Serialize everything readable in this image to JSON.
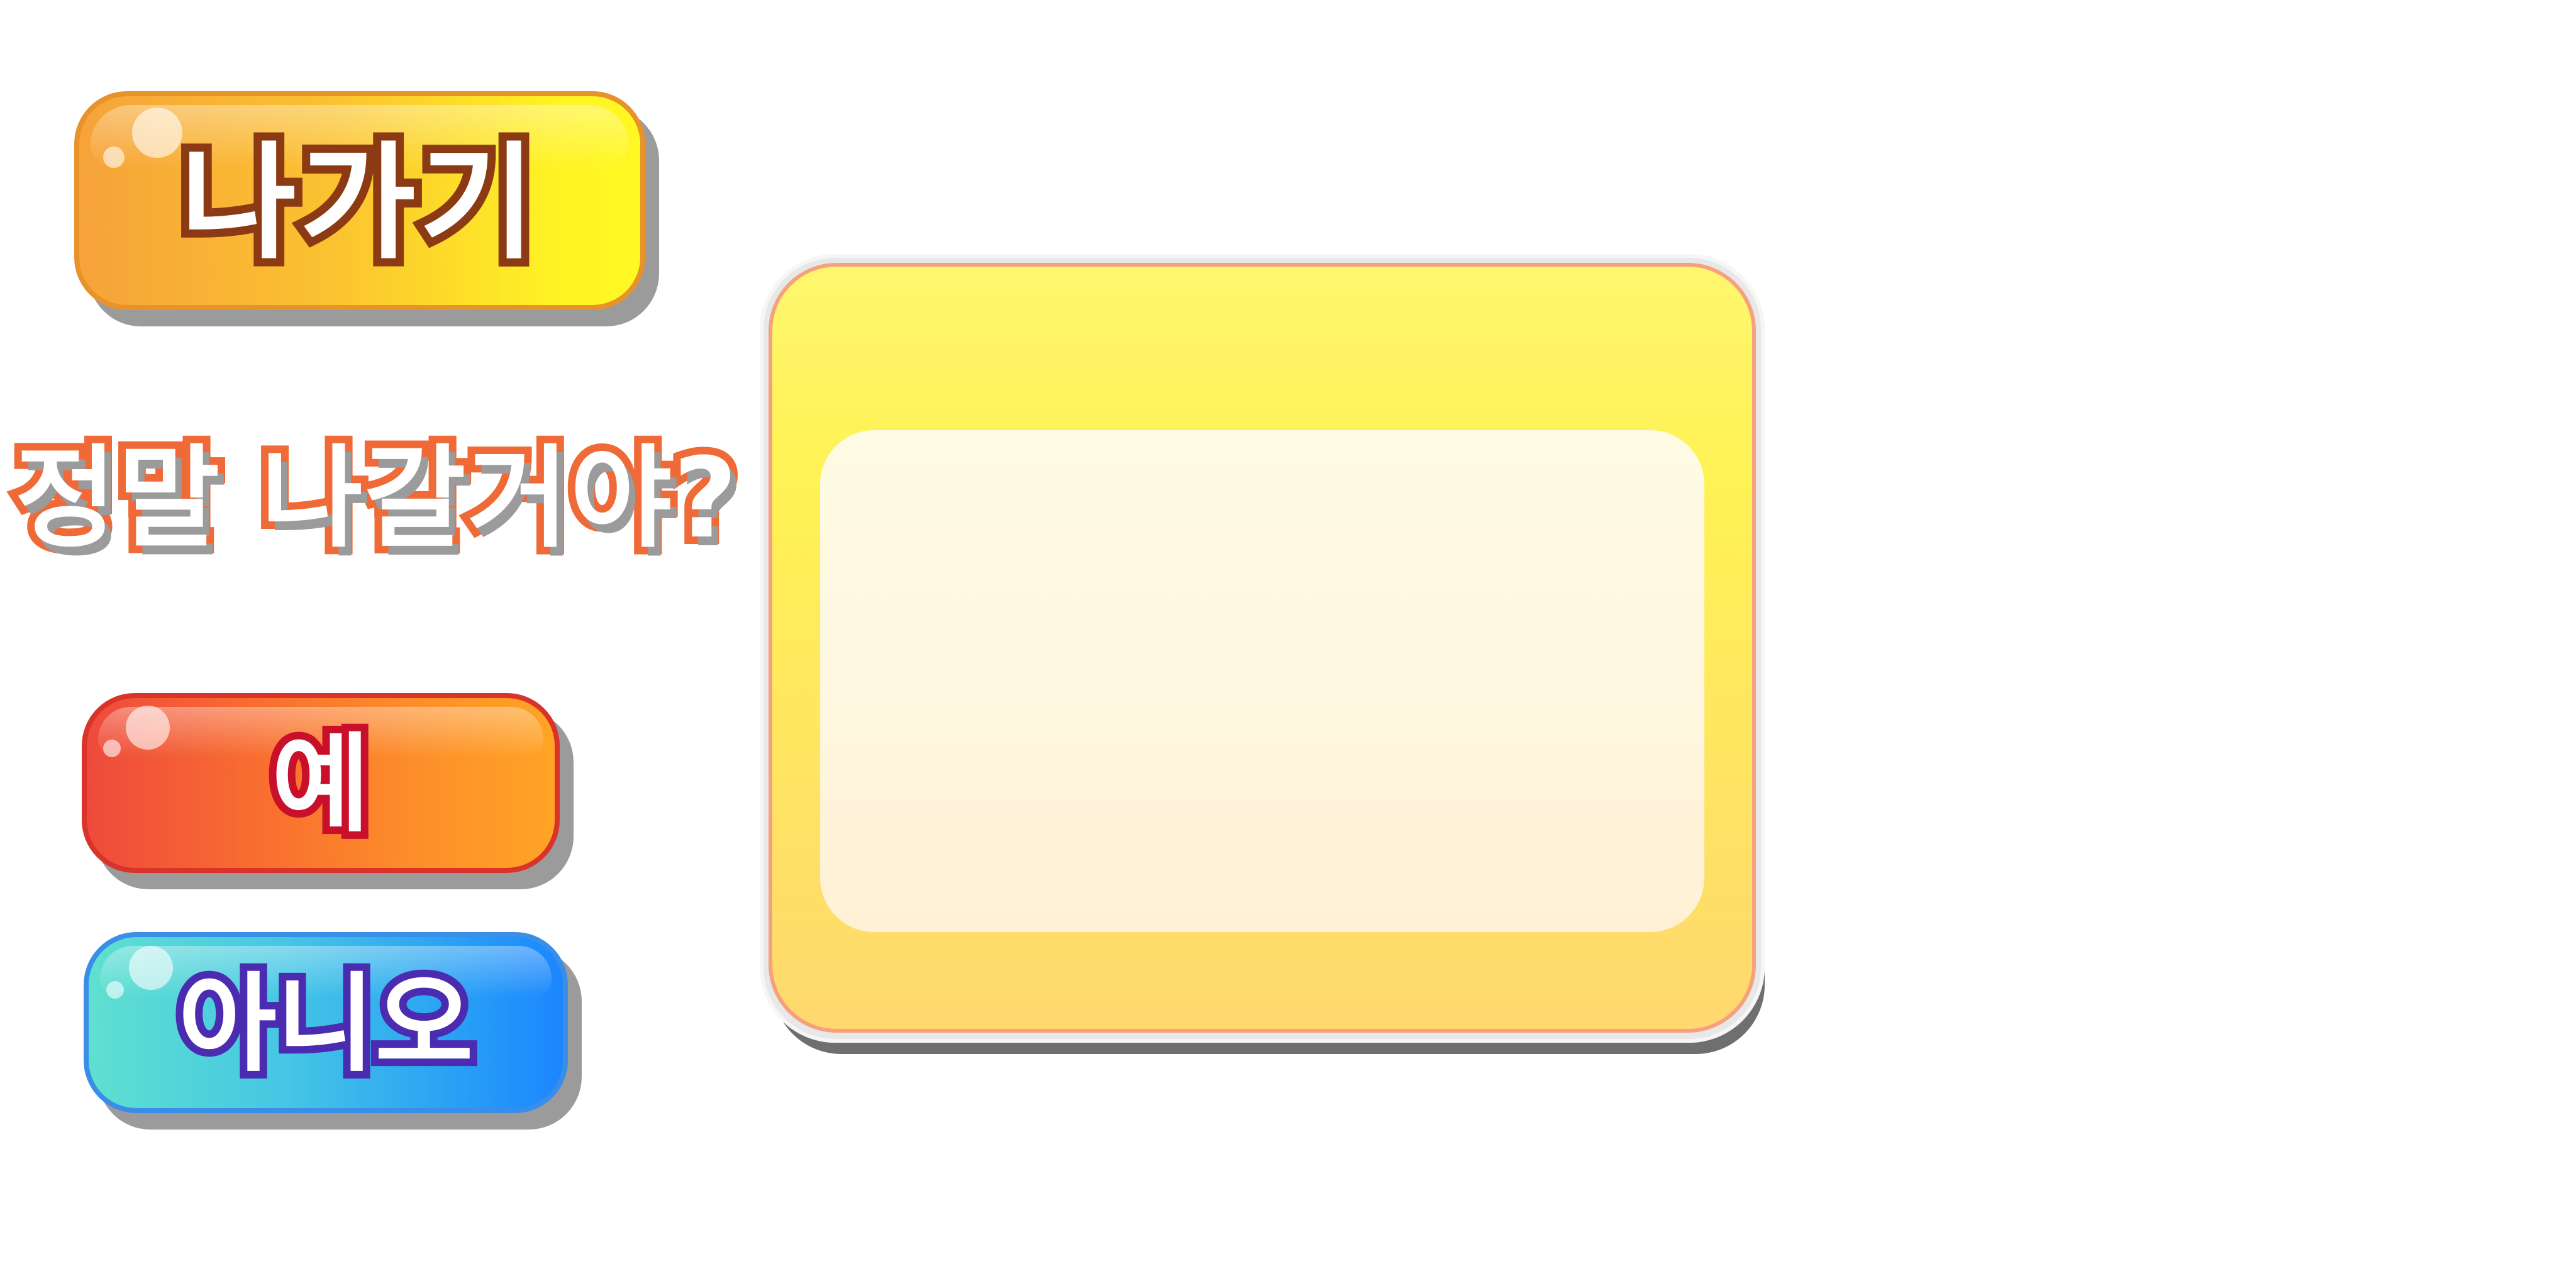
{
  "exit_button": {
    "label": "나가기"
  },
  "confirm_dialog": {
    "question": "정말 나갈거야?",
    "yes_label": "예",
    "no_label": "아니오"
  },
  "colors": {
    "exit_fill_start": "#f6a33a",
    "exit_fill_end": "#fff822",
    "exit_text_outline": "#8c3a14",
    "question_outline": "#ef6a36",
    "yes_fill_start": "#ee4a3c",
    "yes_fill_end": "#ffa425",
    "yes_text_outline": "#c8102a",
    "no_fill_start": "#5fe0cf",
    "no_fill_end": "#1c86ff",
    "no_text_outline": "#4b2bb0",
    "panel_top": "#fff66f",
    "panel_bottom": "#ffd86e",
    "panel_inner": "#fffbe4"
  }
}
